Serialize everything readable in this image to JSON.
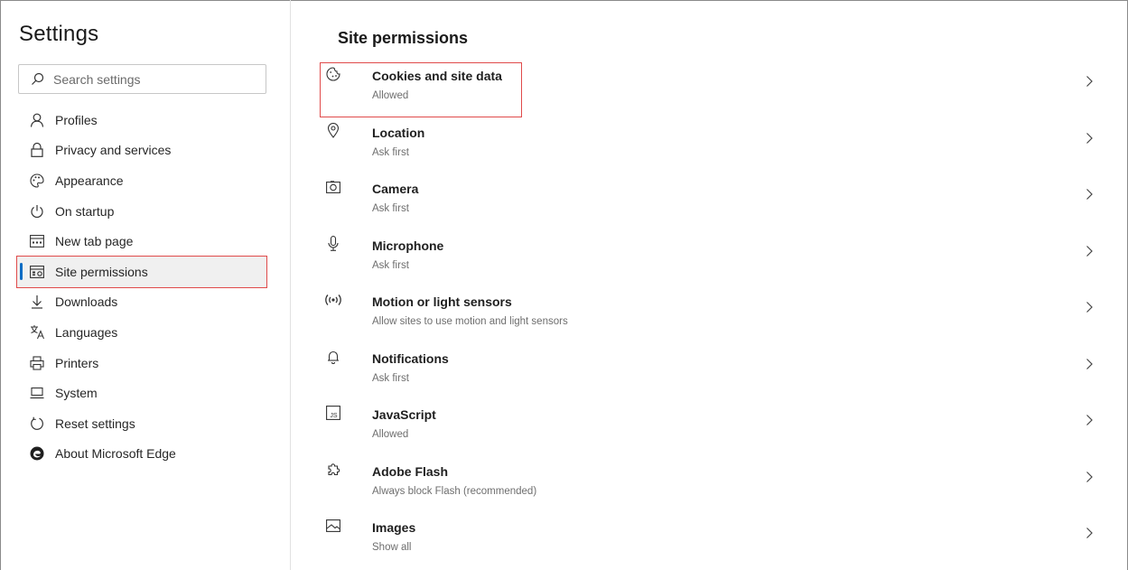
{
  "sidebar": {
    "title": "Settings",
    "search_placeholder": "Search settings",
    "items": [
      {
        "label": "Profiles",
        "icon": "profile-icon"
      },
      {
        "label": "Privacy and services",
        "icon": "lock-icon"
      },
      {
        "label": "Appearance",
        "icon": "palette-icon"
      },
      {
        "label": "On startup",
        "icon": "power-icon"
      },
      {
        "label": "New tab page",
        "icon": "new-tab-icon"
      },
      {
        "label": "Site permissions",
        "icon": "site-permissions-icon",
        "active": true
      },
      {
        "label": "Downloads",
        "icon": "download-icon"
      },
      {
        "label": "Languages",
        "icon": "languages-icon"
      },
      {
        "label": "Printers",
        "icon": "printer-icon"
      },
      {
        "label": "System",
        "icon": "laptop-icon"
      },
      {
        "label": "Reset settings",
        "icon": "reset-icon"
      },
      {
        "label": "About Microsoft Edge",
        "icon": "edge-logo-icon"
      }
    ]
  },
  "main": {
    "title": "Site permissions",
    "permissions": [
      {
        "label": "Cookies and site data",
        "status": "Allowed",
        "icon": "cookie-icon"
      },
      {
        "label": "Location",
        "status": "Ask first",
        "icon": "location-pin-icon"
      },
      {
        "label": "Camera",
        "status": "Ask first",
        "icon": "camera-icon"
      },
      {
        "label": "Microphone",
        "status": "Ask first",
        "icon": "microphone-icon"
      },
      {
        "label": "Motion or light sensors",
        "status": "Allow sites to use motion and light sensors",
        "icon": "sensor-icon"
      },
      {
        "label": "Notifications",
        "status": "Ask first",
        "icon": "bell-icon"
      },
      {
        "label": "JavaScript",
        "status": "Allowed",
        "icon": "javascript-icon"
      },
      {
        "label": "Adobe Flash",
        "status": "Always block Flash (recommended)",
        "icon": "puzzle-icon"
      },
      {
        "label": "Images",
        "status": "Show all",
        "icon": "image-icon"
      }
    ]
  },
  "colors": {
    "accent": "#0c6cc4",
    "highlight": "#e04a4a",
    "active_bg": "#f0f0f0"
  }
}
